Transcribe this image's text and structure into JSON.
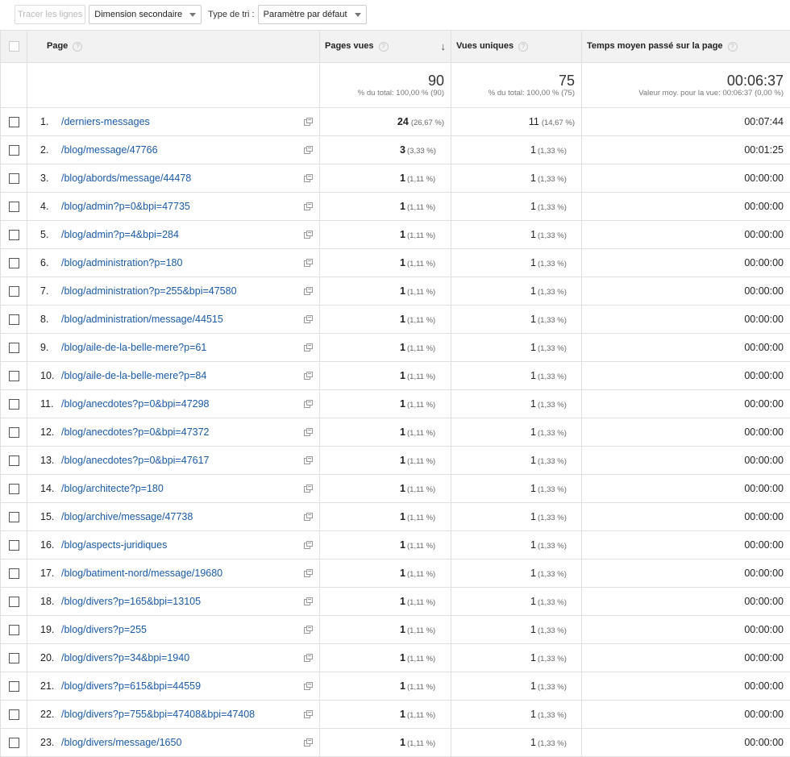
{
  "toolbar": {
    "plot_rows": "Tracer les lignes",
    "secondary_dimension": "Dimension secondaire",
    "sort_type_label": "Type de tri :",
    "sort_type_value": "Paramètre par défaut"
  },
  "columns": {
    "page": "Page",
    "pageviews": "Pages vues",
    "unique": "Vues uniques",
    "avg_time": "Temps moyen passé sur la page"
  },
  "totals": {
    "pageviews": "90",
    "pageviews_sub": "% du total: 100,00 % (90)",
    "unique": "75",
    "unique_sub": "% du total: 100,00 % (75)",
    "avg_time": "00:06:37",
    "avg_time_sub": "Valeur moy. pour la vue: 00:06:37 (0,00 %)"
  },
  "rows": [
    {
      "rank": "1.",
      "page": "/derniers-messages",
      "pv": "24",
      "pv_pct": "(26,67 %)",
      "uv": "11",
      "uv_pct": "(14,67 %)",
      "time": "00:07:44"
    },
    {
      "rank": "2.",
      "page": "/blog/message/47766",
      "pv": "3",
      "pv_pct": "(3,33 %)",
      "uv": "1",
      "uv_pct": "(1,33 %)",
      "time": "00:01:25"
    },
    {
      "rank": "3.",
      "page": "/blog/abords/message/44478",
      "pv": "1",
      "pv_pct": "(1,11 %)",
      "uv": "1",
      "uv_pct": "(1,33 %)",
      "time": "00:00:00"
    },
    {
      "rank": "4.",
      "page": "/blog/admin?p=0&bpi=47735",
      "pv": "1",
      "pv_pct": "(1,11 %)",
      "uv": "1",
      "uv_pct": "(1,33 %)",
      "time": "00:00:00"
    },
    {
      "rank": "5.",
      "page": "/blog/admin?p=4&bpi=284",
      "pv": "1",
      "pv_pct": "(1,11 %)",
      "uv": "1",
      "uv_pct": "(1,33 %)",
      "time": "00:00:00"
    },
    {
      "rank": "6.",
      "page": "/blog/administration?p=180",
      "pv": "1",
      "pv_pct": "(1,11 %)",
      "uv": "1",
      "uv_pct": "(1,33 %)",
      "time": "00:00:00"
    },
    {
      "rank": "7.",
      "page": "/blog/administration?p=255&bpi=47580",
      "pv": "1",
      "pv_pct": "(1,11 %)",
      "uv": "1",
      "uv_pct": "(1,33 %)",
      "time": "00:00:00"
    },
    {
      "rank": "8.",
      "page": "/blog/administration/message/44515",
      "pv": "1",
      "pv_pct": "(1,11 %)",
      "uv": "1",
      "uv_pct": "(1,33 %)",
      "time": "00:00:00"
    },
    {
      "rank": "9.",
      "page": "/blog/aile-de-la-belle-mere?p=61",
      "pv": "1",
      "pv_pct": "(1,11 %)",
      "uv": "1",
      "uv_pct": "(1,33 %)",
      "time": "00:00:00"
    },
    {
      "rank": "10.",
      "page": "/blog/aile-de-la-belle-mere?p=84",
      "pv": "1",
      "pv_pct": "(1,11 %)",
      "uv": "1",
      "uv_pct": "(1,33 %)",
      "time": "00:00:00"
    },
    {
      "rank": "11.",
      "page": "/blog/anecdotes?p=0&bpi=47298",
      "pv": "1",
      "pv_pct": "(1,11 %)",
      "uv": "1",
      "uv_pct": "(1,33 %)",
      "time": "00:00:00"
    },
    {
      "rank": "12.",
      "page": "/blog/anecdotes?p=0&bpi=47372",
      "pv": "1",
      "pv_pct": "(1,11 %)",
      "uv": "1",
      "uv_pct": "(1,33 %)",
      "time": "00:00:00"
    },
    {
      "rank": "13.",
      "page": "/blog/anecdotes?p=0&bpi=47617",
      "pv": "1",
      "pv_pct": "(1,11 %)",
      "uv": "1",
      "uv_pct": "(1,33 %)",
      "time": "00:00:00"
    },
    {
      "rank": "14.",
      "page": "/blog/architecte?p=180",
      "pv": "1",
      "pv_pct": "(1,11 %)",
      "uv": "1",
      "uv_pct": "(1,33 %)",
      "time": "00:00:00"
    },
    {
      "rank": "15.",
      "page": "/blog/archive/message/47738",
      "pv": "1",
      "pv_pct": "(1,11 %)",
      "uv": "1",
      "uv_pct": "(1,33 %)",
      "time": "00:00:00"
    },
    {
      "rank": "16.",
      "page": "/blog/aspects-juridiques",
      "pv": "1",
      "pv_pct": "(1,11 %)",
      "uv": "1",
      "uv_pct": "(1,33 %)",
      "time": "00:00:00"
    },
    {
      "rank": "17.",
      "page": "/blog/batiment-nord/message/19680",
      "pv": "1",
      "pv_pct": "(1,11 %)",
      "uv": "1",
      "uv_pct": "(1,33 %)",
      "time": "00:00:00"
    },
    {
      "rank": "18.",
      "page": "/blog/divers?p=165&bpi=13105",
      "pv": "1",
      "pv_pct": "(1,11 %)",
      "uv": "1",
      "uv_pct": "(1,33 %)",
      "time": "00:00:00"
    },
    {
      "rank": "19.",
      "page": "/blog/divers?p=255",
      "pv": "1",
      "pv_pct": "(1,11 %)",
      "uv": "1",
      "uv_pct": "(1,33 %)",
      "time": "00:00:00"
    },
    {
      "rank": "20.",
      "page": "/blog/divers?p=34&bpi=1940",
      "pv": "1",
      "pv_pct": "(1,11 %)",
      "uv": "1",
      "uv_pct": "(1,33 %)",
      "time": "00:00:00"
    },
    {
      "rank": "21.",
      "page": "/blog/divers?p=615&bpi=44559",
      "pv": "1",
      "pv_pct": "(1,11 %)",
      "uv": "1",
      "uv_pct": "(1,33 %)",
      "time": "00:00:00"
    },
    {
      "rank": "22.",
      "page": "/blog/divers?p=755&bpi=47408&bpi=47408",
      "pv": "1",
      "pv_pct": "(1,11 %)",
      "uv": "1",
      "uv_pct": "(1,33 %)",
      "time": "00:00:00"
    },
    {
      "rank": "23.",
      "page": "/blog/divers/message/1650",
      "pv": "1",
      "pv_pct": "(1,11 %)",
      "uv": "1",
      "uv_pct": "(1,33 %)",
      "time": "00:00:00"
    }
  ]
}
